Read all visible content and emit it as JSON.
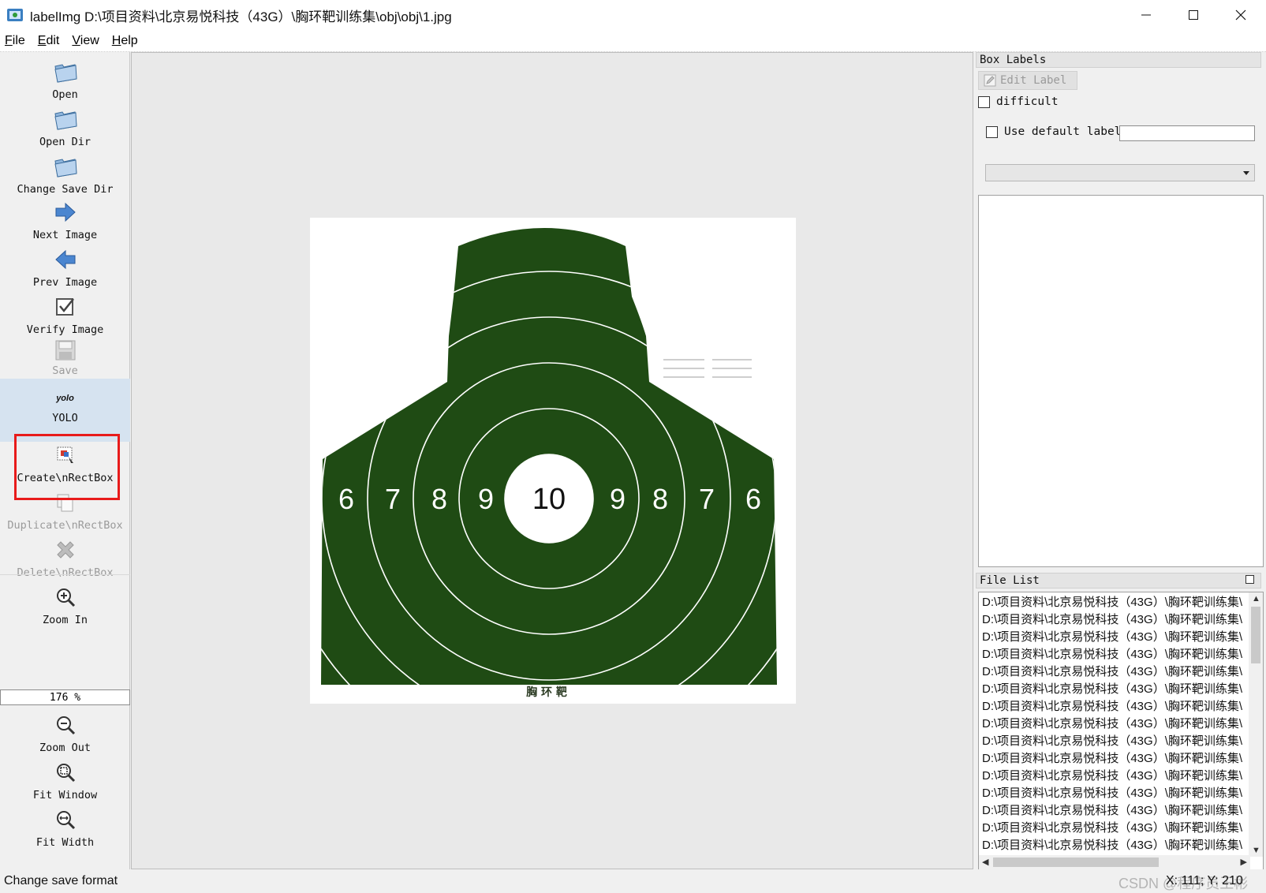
{
  "window": {
    "title": "labelImg D:\\项目资料\\北京易悦科技（43G）\\胸环靶训练集\\obj\\obj\\1.jpg"
  },
  "menu": [
    "File",
    "Edit",
    "View",
    "Help"
  ],
  "toolbar": {
    "open": "Open",
    "open_dir": "Open Dir",
    "change_save_dir": "Change Save Dir",
    "next_image": "Next Image",
    "prev_image": "Prev Image",
    "verify_image": "Verify Image",
    "save": "Save",
    "yolo_icon_text": "yolo",
    "yolo": "YOLO",
    "create_rect": "Create\\nRectBox",
    "duplicate_rect": "Duplicate\\nRectBox",
    "delete_rect": "Delete\\nRectBox",
    "zoom_in": "Zoom In",
    "zoom_value": "176 %",
    "zoom_out": "Zoom Out",
    "fit_window": "Fit Window",
    "fit_width": "Fit Width"
  },
  "target": {
    "rings_left": [
      "6",
      "7",
      "8",
      "9"
    ],
    "center": "10",
    "rings_right": [
      "9",
      "8",
      "7",
      "6"
    ],
    "caption": "胸 环 靶",
    "green": "#1f4b14"
  },
  "box_labels": {
    "title": "Box Labels",
    "edit_label": "Edit Label",
    "difficult": "difficult",
    "use_default_label": "Use default label",
    "default_label_value": "",
    "selected_label": ""
  },
  "file_list": {
    "title": "File List",
    "items": [
      "D:\\项目资料\\北京易悦科技（43G）\\胸环靶训练集\\",
      "D:\\项目资料\\北京易悦科技（43G）\\胸环靶训练集\\",
      "D:\\项目资料\\北京易悦科技（43G）\\胸环靶训练集\\",
      "D:\\项目资料\\北京易悦科技（43G）\\胸环靶训练集\\",
      "D:\\项目资料\\北京易悦科技（43G）\\胸环靶训练集\\",
      "D:\\项目资料\\北京易悦科技（43G）\\胸环靶训练集\\",
      "D:\\项目资料\\北京易悦科技（43G）\\胸环靶训练集\\",
      "D:\\项目资料\\北京易悦科技（43G）\\胸环靶训练集\\",
      "D:\\项目资料\\北京易悦科技（43G）\\胸环靶训练集\\",
      "D:\\项目资料\\北京易悦科技（43G）\\胸环靶训练集\\",
      "D:\\项目资料\\北京易悦科技（43G）\\胸环靶训练集\\",
      "D:\\项目资料\\北京易悦科技（43G）\\胸环靶训练集\\",
      "D:\\项目资料\\北京易悦科技（43G）\\胸环靶训练集\\",
      "D:\\项目资料\\北京易悦科技（43G）\\胸环靶训练集\\",
      "D:\\项目资料\\北京易悦科技（43G）\\胸环靶训练集\\"
    ]
  },
  "status": {
    "message": "Change save format",
    "coords": "X: 111; Y: 210",
    "watermark": "CSDN @程序员王彬"
  }
}
